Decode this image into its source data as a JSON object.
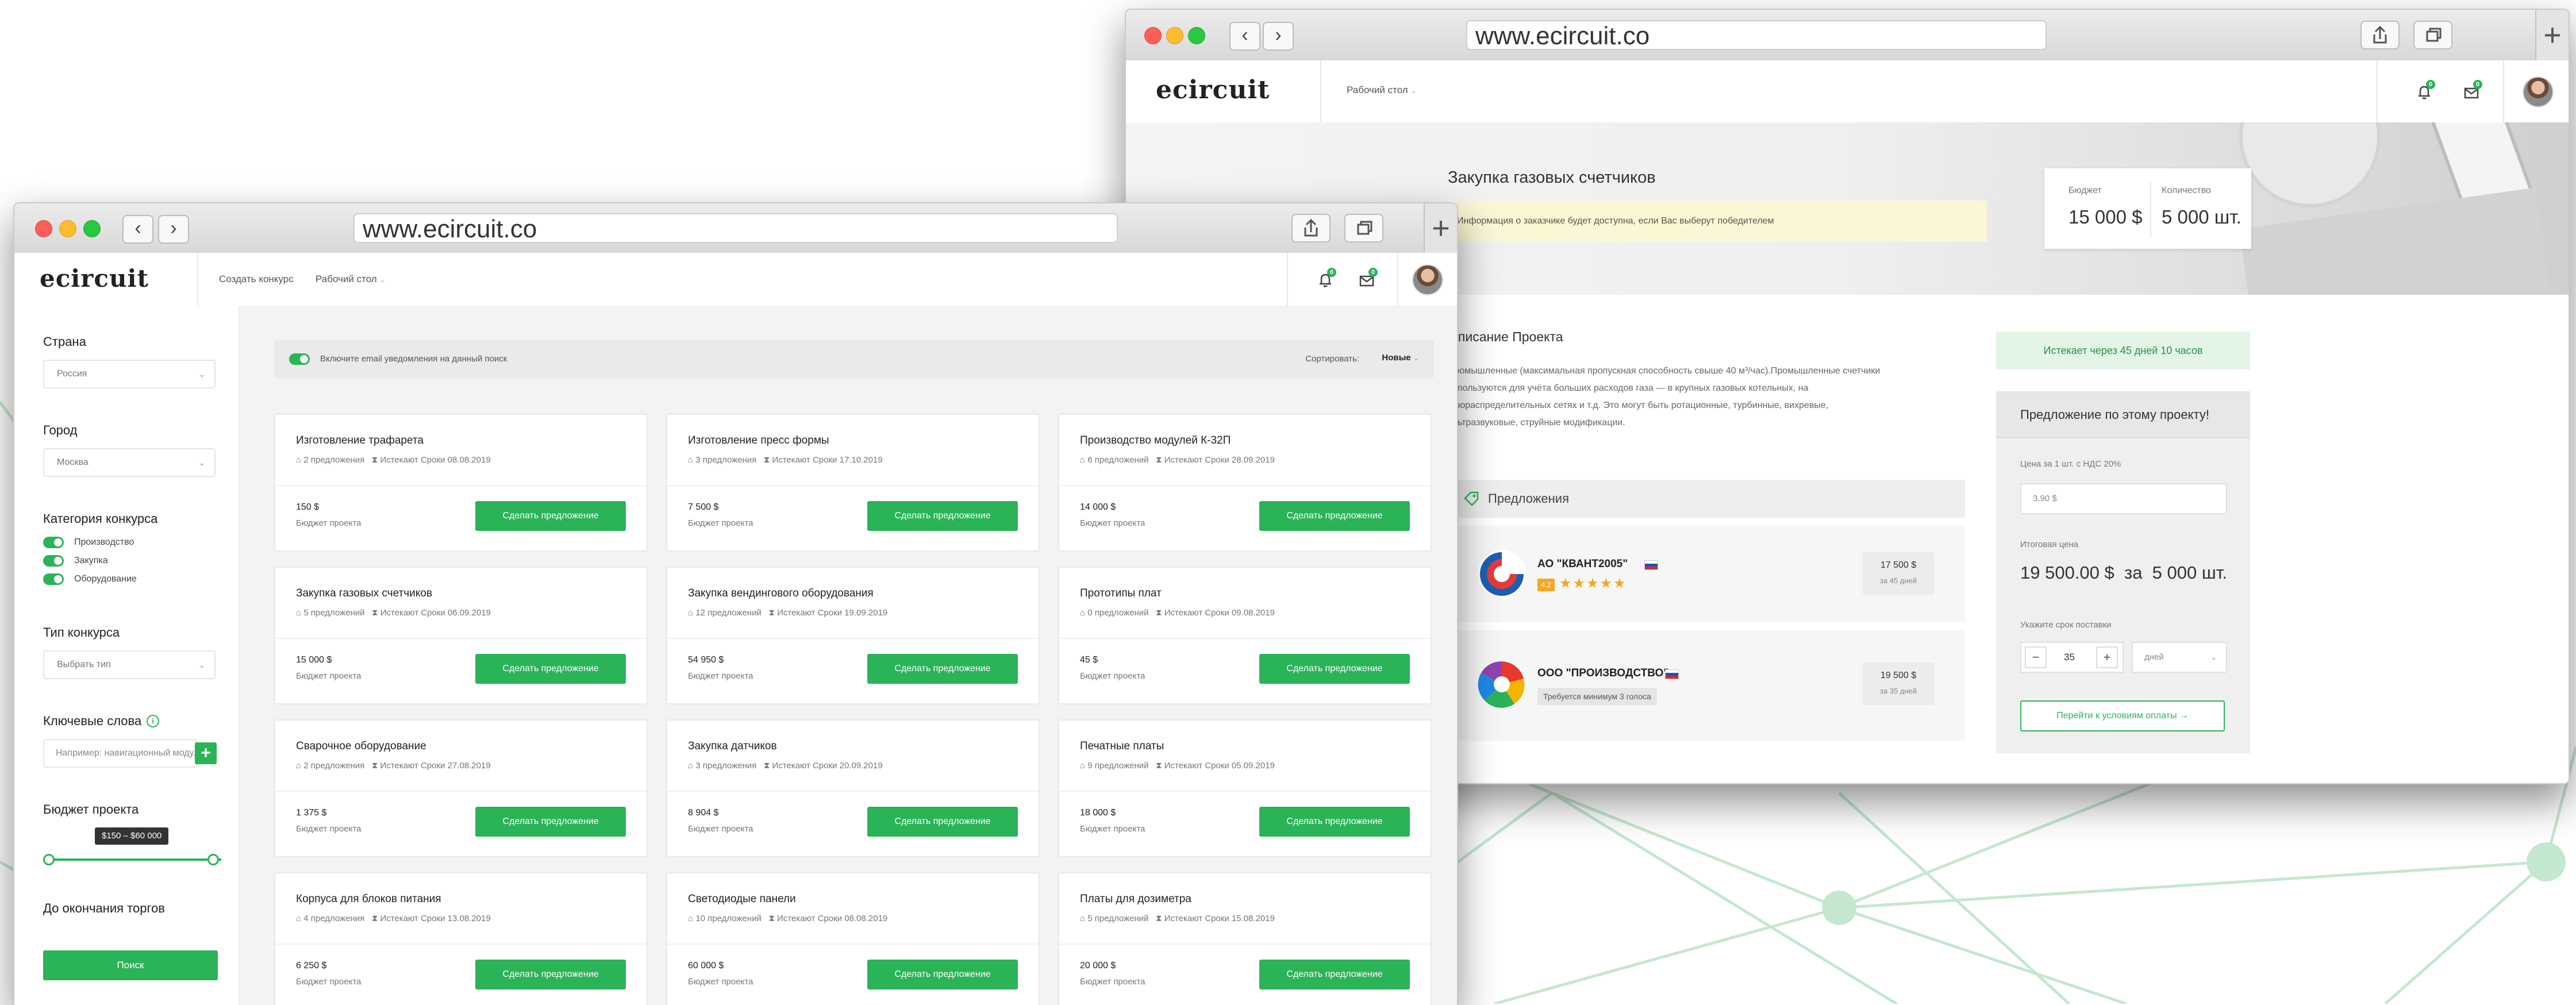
{
  "browser": {
    "url": "www.ecircuit.co"
  },
  "app": {
    "logo": "ecircuit"
  },
  "left_window": {
    "nav": {
      "create_contest": "Создать конкурс",
      "dashboard": "Рабочий стол"
    },
    "notifications": {
      "bell_count": "0",
      "messages_count": "0"
    },
    "sidebar": {
      "country_label": "Страна",
      "country_value": "Россия",
      "city_label": "Город",
      "city_value": "Москва",
      "category_label": "Категория конкурса",
      "categories": [
        "Производство",
        "Закупка",
        "Оборудование"
      ],
      "type_label": "Тип конкурса",
      "type_value": "Выбрать тип",
      "keywords_label": "Ключевые слова",
      "keywords_placeholder": "Например: навигационный модуль",
      "keywords_add": "+",
      "budget_label": "Бюджет проекта",
      "budget_range": "$150 – $60 000",
      "deadline_label": "До окончания торгов",
      "search_button": "Поиск"
    },
    "filter": {
      "email_toggle_label": "Включите email уведомления на данный поиск",
      "sort_label": "Сортировать:",
      "sort_value": "Новые"
    },
    "cards": [
      {
        "title": "Изготовление трафарета",
        "offers": "2 предложения",
        "expires": "Истекают Сроки 08.08.2019",
        "price": "150 $",
        "budget": "Бюджет проекта",
        "button": "Сделать предложение"
      },
      {
        "title": "Изготовление пресс формы",
        "offers": "3 предложения",
        "expires": "Истекают Сроки 17.10.2019",
        "price": "7 500 $",
        "budget": "Бюджет проекта",
        "button": "Сделать предложение"
      },
      {
        "title": "Производство модулей К-32П",
        "offers": "6 предложений",
        "expires": "Истекают Сроки 28.09.2019",
        "price": "14 000 $",
        "budget": "Бюджет проекта",
        "button": "Сделать предложение"
      },
      {
        "title": "Закупка газовых счетчиков",
        "offers": "5 предложений",
        "expires": "Истекают Сроки 06.09.2019",
        "price": "15 000 $",
        "budget": "Бюджет проекта",
        "button": "Сделать предложение"
      },
      {
        "title": "Закупка вендингового оборудования",
        "offers": "12 предложений",
        "expires": "Истекают Сроки 19.09.2019",
        "price": "54 950 $",
        "budget": "Бюджет проекта",
        "button": "Сделать предложение"
      },
      {
        "title": "Прототипы плат",
        "offers": "0 предложений",
        "expires": "Истекают Сроки 09.08.2019",
        "price": "45 $",
        "budget": "Бюджет проекта",
        "button": "Сделать предложение"
      },
      {
        "title": "Сварочное оборудование",
        "offers": "2 предложения",
        "expires": "Истекают Сроки 27.08.2019",
        "price": "1 375 $",
        "budget": "Бюджет проекта",
        "button": "Сделать предложение"
      },
      {
        "title": "Закупка датчиков",
        "offers": "3 предложения",
        "expires": "Истекают Сроки 20.09.2019",
        "price": "8 904 $",
        "budget": "Бюджет проекта",
        "button": "Сделать предложение"
      },
      {
        "title": "Печатные платы",
        "offers": "9 предложений",
        "expires": "Истекают Сроки 05.09.2019",
        "price": "18 000 $",
        "budget": "Бюджет проекта",
        "button": "Сделать предложение"
      },
      {
        "title": "Корпуса для блоков питания",
        "offers": "4 предложения",
        "expires": "Истекают Сроки 13.08.2019",
        "price": "6 250 $",
        "budget": "Бюджет проекта",
        "button": "Сделать предложение"
      },
      {
        "title": "Светодиодые панели",
        "offers": "10 предложений",
        "expires": "Истекают Сроки 08.08.2019",
        "price": "60 000 $",
        "budget": "Бюджет проекта",
        "button": "Сделать предложение"
      },
      {
        "title": "Платы для дозиметра",
        "offers": "5 предложений",
        "expires": "Истекают Сроки 15.08.2019",
        "price": "20 000 $",
        "budget": "Бюджет проекта",
        "button": "Сделать предложение"
      }
    ]
  },
  "right_window": {
    "nav": {
      "dashboard": "Рабочий стол"
    },
    "notifications": {
      "bell_count": "0",
      "messages_count": "0"
    },
    "project": {
      "title": "Закупка газовых счетчиков",
      "customer_info": "Информация о заказчике будет доступна, если Вас выберут победителем",
      "budget_label": "Бюджет",
      "budget_value": "15 000 $",
      "quantity_label": "Количество",
      "quantity_value": "5 000 шт.",
      "description_title": "Описание Проекта",
      "description_lines": [
        "Промышленные (максимальная пропускная способность свыше 40 м³/час).Промышленные счетчики",
        "используются для учёта больших расходов газа — в крупных газовых котельных, на",
        "газораспределительных сетях и т.д. Это могут быть ротационные, турбинные, вихревые,",
        "ультразвуковые, струйные модификации."
      ],
      "offers_title": "Предложения",
      "offers": [
        {
          "company": "АО \"КВАНТ2005\"",
          "rating": "4.2",
          "stars": "★★★★★",
          "price": "17 500 $",
          "days": "за 45 дней"
        },
        {
          "company": "ООО \"ПРОИЗВОДСТВО\"",
          "votes_note": "Требуется минимум 3 голоса",
          "price": "19 500 $",
          "days": "за 35 дней"
        }
      ]
    },
    "offer_panel": {
      "expires": "Истекает через 45 дней 10 часов",
      "title": "Предложение по этому проекту!",
      "price_label": "Цена за 1 шт. с НДС 20%",
      "price_value": "3.90 $",
      "total_label": "Итоговая цена",
      "total_value": "19 500.00 $  за  5 000 шт.",
      "delivery_label": "Укажите срок поставки",
      "minus": "−",
      "delivery_value": "35",
      "plus": "+",
      "unit": "дней",
      "submit": "Перейти к условиям оплаты →"
    }
  },
  "colors": {
    "accent": "#2bb358",
    "background_lines": "#b9e3c6"
  }
}
